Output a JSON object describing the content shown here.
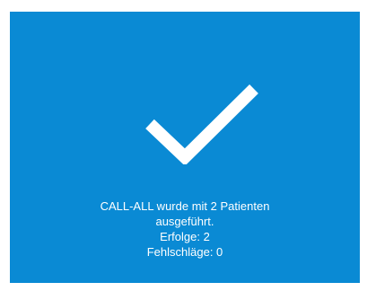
{
  "colors": {
    "panel": "#0a8ad4",
    "foreground": "#ffffff"
  },
  "icon": "checkmark-icon",
  "message": {
    "line1": "CALL-ALL wurde mit 2 Patienten",
    "line2": "ausgeführt.",
    "line3": "Erfolge: 2",
    "line4": "Fehlschläge: 0"
  }
}
